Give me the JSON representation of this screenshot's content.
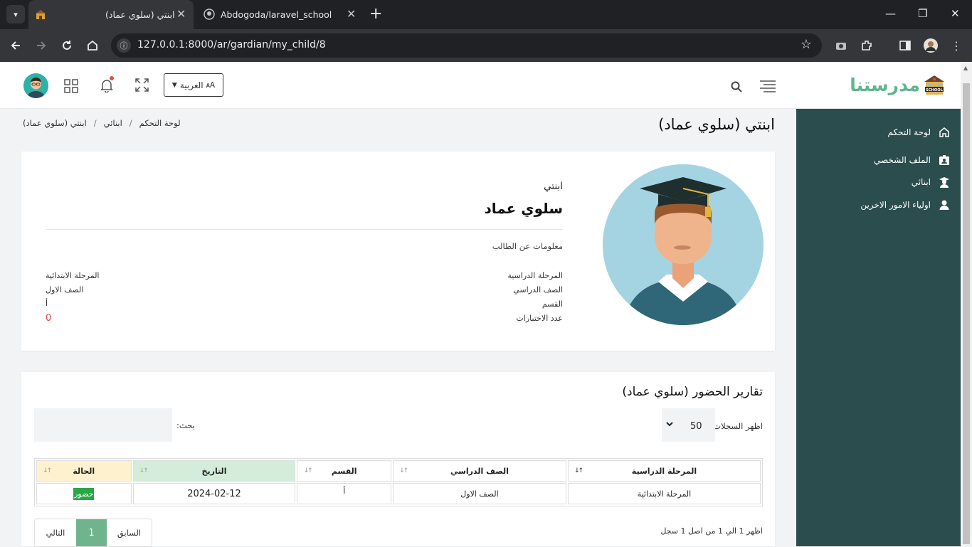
{
  "browser": {
    "tabs": [
      {
        "title": "ابنتي (سلوي عماد)",
        "active": true
      },
      {
        "title": "Abdogoda/laravel_school",
        "active": false
      }
    ],
    "url": "127.0.0.1:8000/ar/gardian/my_child/8"
  },
  "header": {
    "language_label": "العربية",
    "logo_text": "مدرستنا",
    "logo_badge": "SCHOOL"
  },
  "sidebar": {
    "items": [
      {
        "label": "لوحة التحكم",
        "icon": "home-icon"
      },
      {
        "label": "الملف الشخصي",
        "icon": "id-card-icon"
      },
      {
        "label": "ابنائي",
        "icon": "graduate-icon"
      },
      {
        "label": "اولياء الامور الاخرين",
        "icon": "user-icon"
      }
    ]
  },
  "page": {
    "title": "ابنتي (سلوي عماد)",
    "breadcrumb": [
      "لوحة التحكم",
      "ابنائي",
      "ابنتي (سلوي عماد)"
    ]
  },
  "profile": {
    "label": "ابنتي",
    "name": "سلوي عماد",
    "info_heading": "معلومات عن الطالب",
    "fields": [
      {
        "label": "المرحلة الدراسية",
        "value": "المرحلة الابتدائية"
      },
      {
        "label": "الصف الدراسي",
        "value": "الصف الاول"
      },
      {
        "label": "القسم",
        "value": "أ"
      },
      {
        "label": "عدد الاختبارات",
        "value": "0"
      }
    ]
  },
  "attendance": {
    "title": "تقارير الحضور (سلوي عماد)",
    "length_label": "اظهر السجلات",
    "length_value": "50",
    "search_label": "بحث:",
    "columns": [
      "المرحلة الدراسية",
      "الصف الدراسي",
      "القسم",
      "التاريخ",
      "الحالة"
    ],
    "rows": [
      {
        "stage": "المرحلة الابتدائية",
        "grade": "الصف الاول",
        "section": "أ",
        "date": "2024-02-12",
        "status": "حضور"
      }
    ],
    "info": "اظهر 1 الي 1 من اصل 1 سجل",
    "pager": {
      "prev": "السابق",
      "current": "1",
      "next": "التالي"
    },
    "colors": {
      "present": "#28a745",
      "date_sort": "#d4eddb",
      "status_sort": "#fdf2cd"
    }
  },
  "colors": {
    "sidebar": "#2b4d4e",
    "brand": "#5fb58e",
    "accent": "#6fb48d"
  }
}
